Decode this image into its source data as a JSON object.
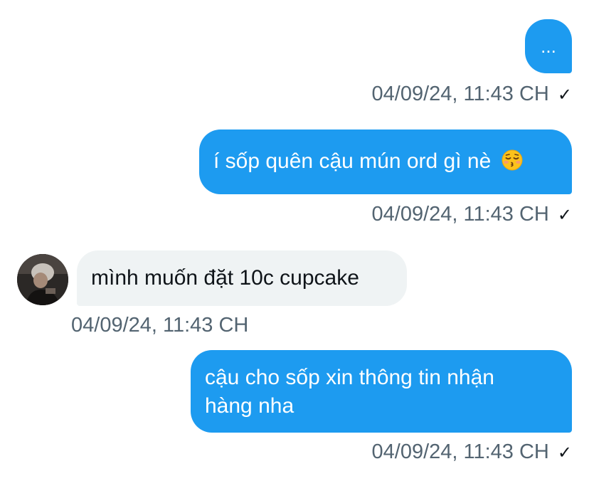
{
  "conversation": {
    "messages": [
      {
        "sender": "me",
        "text": "...",
        "timestamp": "04/09/24, 11:43 CH",
        "read_icon": "check-icon"
      },
      {
        "sender": "me",
        "text": "í sốp quên cậu mún ord gì nè",
        "emoji": "kissing-face-with-closed-eyes-emoji",
        "timestamp": "04/09/24, 11:43 CH",
        "read_icon": "check-icon"
      },
      {
        "sender": "other",
        "text": "mình muốn đặt 10c cupcake",
        "timestamp": "04/09/24, 11:43 CH",
        "avatar": "user-avatar"
      },
      {
        "sender": "me",
        "text_line1": "cậu cho sốp xin thông tin nhận",
        "text_line2": "hàng nha",
        "timestamp": "04/09/24, 11:43 CH",
        "read_icon": "check-icon"
      }
    ]
  },
  "colors": {
    "sent_bubble": "#1d9bf0",
    "received_bubble": "#eff3f4",
    "timestamp_text": "#536471",
    "primary_text": "#0f1419"
  }
}
